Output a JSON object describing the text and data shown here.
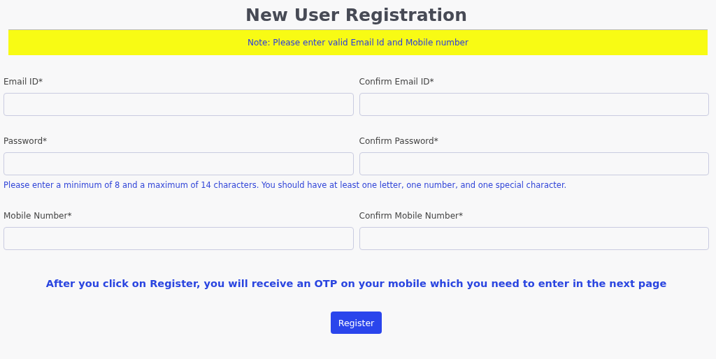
{
  "title": "New User Registration",
  "note": "Note: Please enter valid Email Id and Mobile number",
  "field_rows": [
    {
      "fields": [
        {
          "label": "Email ID*"
        },
        {
          "label": "Confirm Email ID*"
        }
      ]
    },
    {
      "fields": [
        {
          "label": "Password*"
        },
        {
          "label": "Confirm Password*"
        }
      ],
      "hint": "Please enter a minimum of 8 and a maximum of 14 characters. You should have at least one letter, one number, and one special character."
    },
    {
      "fields": [
        {
          "label": "Mobile Number*"
        },
        {
          "label": "Confirm Mobile Number*"
        }
      ]
    }
  ],
  "otp_message": "After you click on Register, you will receive an OTP on your mobile which you need to enter in the next page",
  "button": "Register"
}
